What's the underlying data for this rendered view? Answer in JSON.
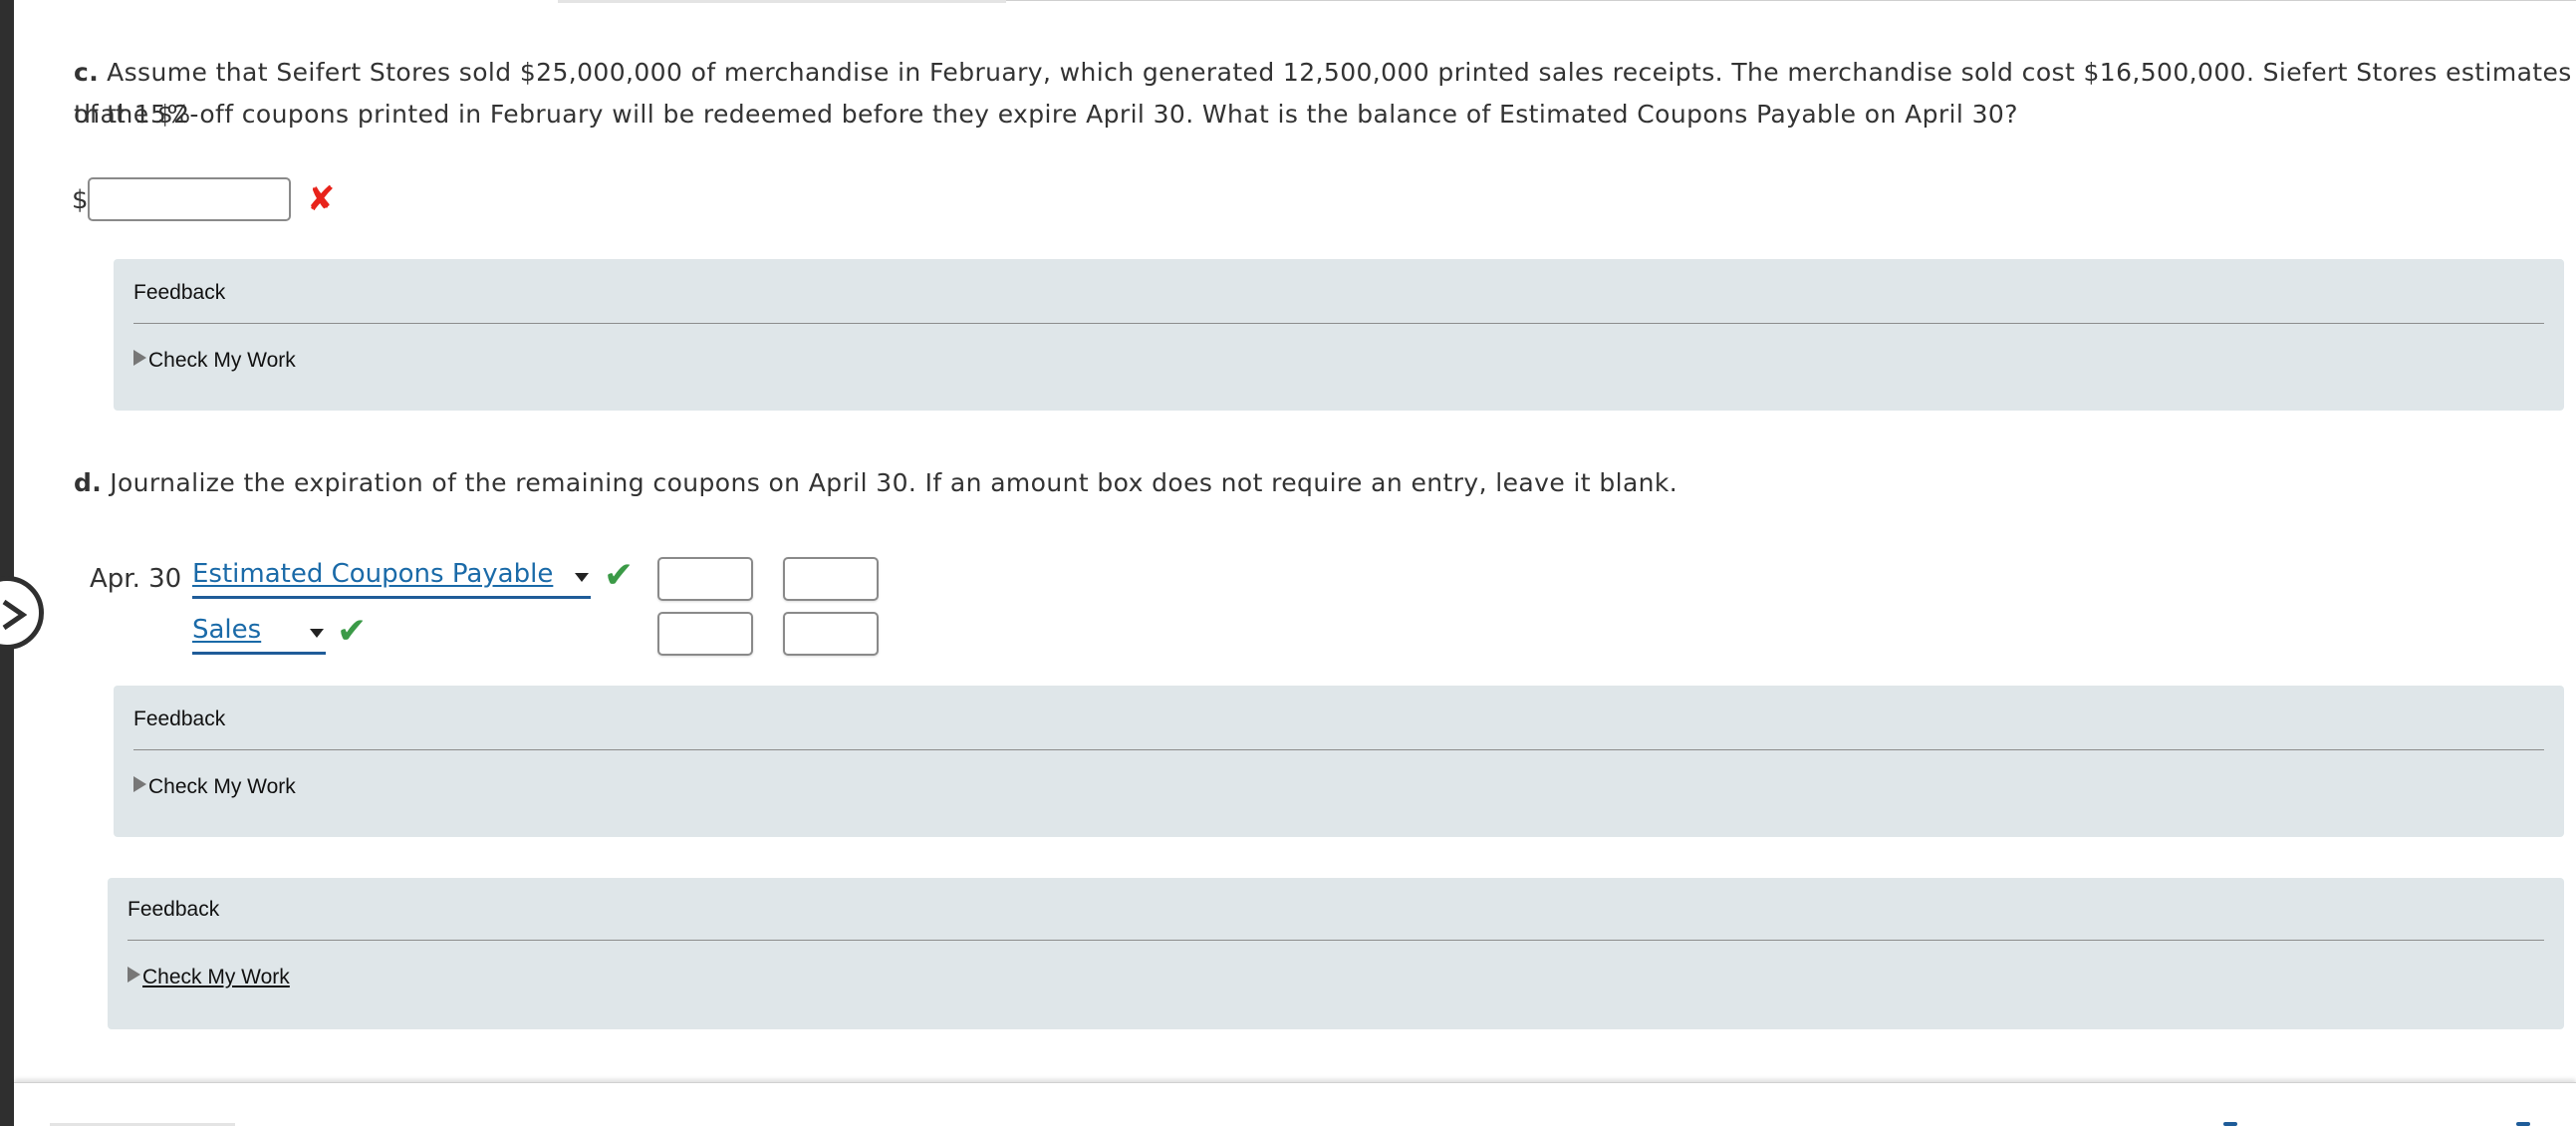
{
  "part_c": {
    "letter": "c.",
    "line1": "Assume that Seifert Stores sold $25,000,000 of merchandise in February, which generated 12,500,000 printed sales receipts. The merchandise sold cost $16,500,000. Siefert Stores estimates that 15%",
    "line2": "of the $2-off coupons printed in February will be redeemed before they expire April 30. What is the balance of Estimated Coupons Payable on April 30?",
    "currency_symbol": "$",
    "answer_value": "",
    "result_mark": "✘"
  },
  "feedback_c": {
    "label": "Feedback",
    "toggle": "Check My Work"
  },
  "part_d": {
    "letter": "d.",
    "text": "Journalize the expiration of the remaining coupons on April 30. If an amount box does not require an entry, leave it blank.",
    "date": "Apr. 30",
    "rows": [
      {
        "account": "Estimated Coupons Payable",
        "mark": "✔",
        "debit": "",
        "credit": ""
      },
      {
        "account": "Sales",
        "mark": "✔",
        "debit": "",
        "credit": ""
      }
    ]
  },
  "feedback_d": {
    "label": "Feedback",
    "toggle": "Check My Work"
  },
  "feedback_overall": {
    "label": "Feedback",
    "toggle": "Check My Work"
  },
  "colors": {
    "correct": "#3b9a47",
    "incorrect": "#e8231b",
    "link": "#1a6aa8",
    "feedback_bg": "#dfe6e9"
  },
  "icons": {
    "nav": "chevron-right-icon",
    "toggle": "triangle-right-icon"
  }
}
